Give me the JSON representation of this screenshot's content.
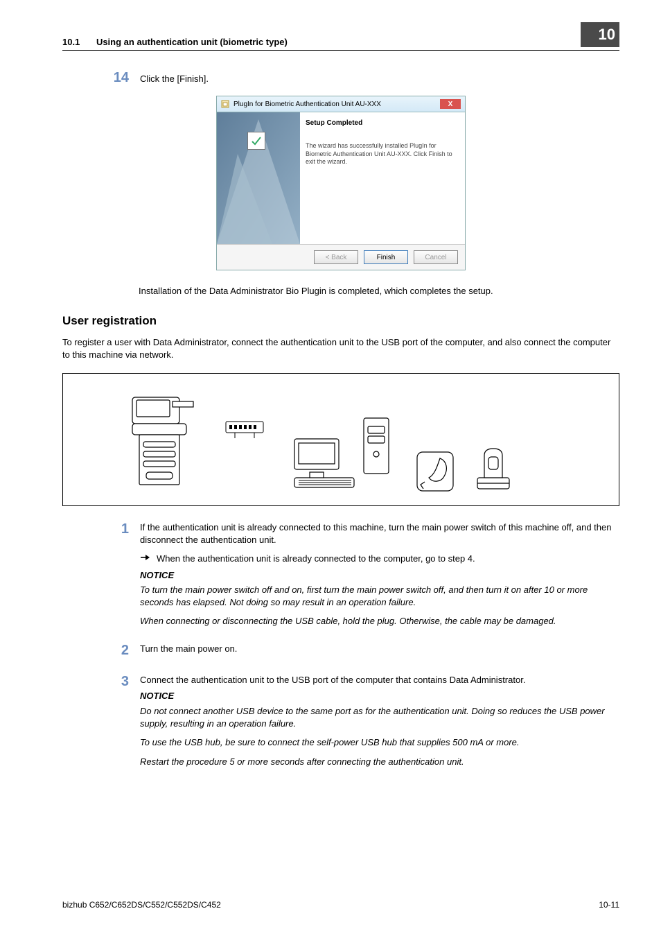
{
  "header": {
    "section_number": "10.1",
    "section_title": "Using an authentication unit (biometric type)",
    "chapter_number": "10"
  },
  "step14": {
    "num": "14",
    "text": "Click the [Finish]."
  },
  "dialog": {
    "title": "PlugIn for Biometric Authentication Unit AU-XXX",
    "heading": "Setup Completed",
    "body": "The wizard has successfully installed PlugIn for Biometric Authentication Unit AU-XXX. Click Finish to exit the wizard.",
    "back": "< Back",
    "finish": "Finish",
    "cancel": "Cancel",
    "close_x": "X"
  },
  "caption": "Installation of the Data Administrator Bio Plugin is completed, which completes the setup.",
  "subheading": "User registration",
  "intro": "To register a user with Data Administrator, connect the authentication unit to the USB port of the computer, and also connect the computer to this machine via network.",
  "step1": {
    "num": "1",
    "text": "If the authentication unit is already connected to this machine, turn the main power switch of this machine off, and then disconnect the authentication unit.",
    "sub": "When the authentication unit is already connected to the computer, go to step 4.",
    "notice": "NOTICE",
    "note1": "To turn the main power switch off and on, first turn the main power switch off, and then turn it on after 10 or more seconds has elapsed. Not doing so may result in an operation failure.",
    "note2": "When connecting or disconnecting the USB cable, hold the plug. Otherwise, the cable may be damaged."
  },
  "step2": {
    "num": "2",
    "text": "Turn the main power on."
  },
  "step3": {
    "num": "3",
    "text": "Connect the authentication unit to the USB port of the computer that contains Data Administrator.",
    "notice": "NOTICE",
    "note1": "Do not connect another USB device to the same port as for the authentication unit. Doing so reduces the USB power supply, resulting in an operation failure.",
    "note2": "To use the USB hub, be sure to connect the self-power USB hub that supplies 500 mA or more.",
    "note3": "Restart the procedure 5 or more seconds after connecting the authentication unit."
  },
  "footer": {
    "model": "bizhub C652/C652DS/C552/C552DS/C452",
    "page": "10-11"
  }
}
